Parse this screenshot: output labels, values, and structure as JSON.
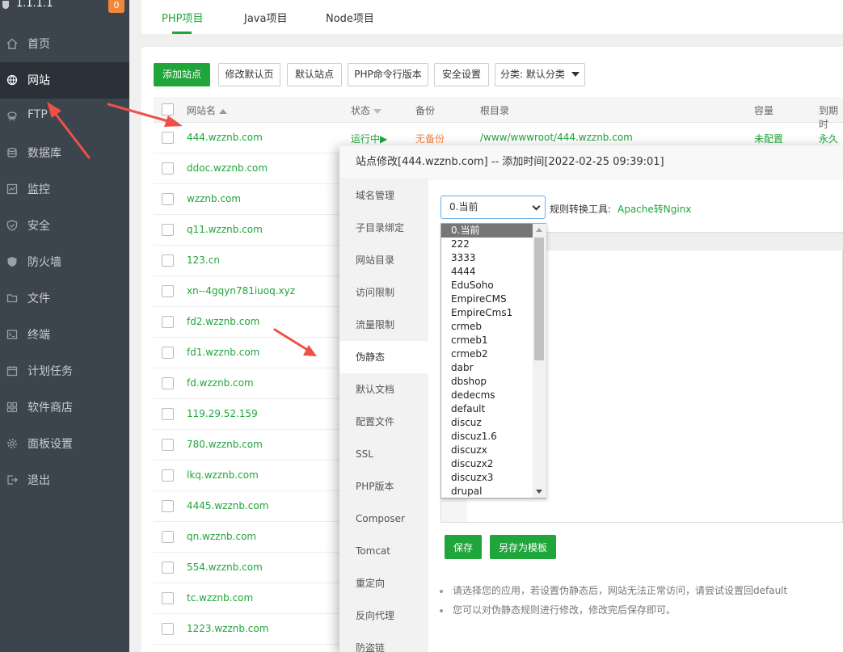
{
  "colors": {
    "accent": "#20a53a",
    "sidebar": "#3c444d",
    "badge": "#f0883c",
    "warn": "#f0883c",
    "arrow": "#f0504a"
  },
  "sidebar": {
    "server_ip": "1.1.1.1",
    "badge_count": "0",
    "items": [
      {
        "label": "首页",
        "icon": "home-icon"
      },
      {
        "label": "网站",
        "icon": "globe-icon"
      },
      {
        "label": "FTP",
        "icon": "ftp-icon"
      },
      {
        "label": "数据库",
        "icon": "database-icon"
      },
      {
        "label": "监控",
        "icon": "monitor-icon"
      },
      {
        "label": "安全",
        "icon": "shield-icon"
      },
      {
        "label": "防火墙",
        "icon": "firewall-icon"
      },
      {
        "label": "文件",
        "icon": "folder-icon"
      },
      {
        "label": "终端",
        "icon": "terminal-icon"
      },
      {
        "label": "计划任务",
        "icon": "calendar-icon"
      },
      {
        "label": "软件商店",
        "icon": "apps-icon"
      },
      {
        "label": "面板设置",
        "icon": "gear-icon"
      },
      {
        "label": "退出",
        "icon": "logout-icon"
      }
    ]
  },
  "top_tabs": [
    "PHP项目",
    "Java项目",
    "Node项目"
  ],
  "toolbar": {
    "add_site": "添加站点",
    "modify_default_page": "修改默认页",
    "default_site": "默认站点",
    "php_cli_version": "PHP命令行版本",
    "security_settings": "安全设置",
    "category": "分类: 默认分类"
  },
  "table": {
    "headers": {
      "site_name": "网站名",
      "status": "状态",
      "backup": "备份",
      "root_dir": "根目录",
      "quota": "容量",
      "expire": "到期时"
    },
    "first_row": {
      "status": "运行中▶",
      "backup": "无备份",
      "root": "/www/wwwroot/444.wzznb.com",
      "quota": "未配置",
      "expire": "永久"
    },
    "sites": [
      "444.wzznb.com",
      "ddoc.wzznb.com",
      "wzznb.com",
      "q11.wzznb.com",
      "123.cn",
      "xn--4gqyn781iuoq.xyz",
      "fd2.wzznb.com",
      "fd1.wzznb.com",
      "fd.wzznb.com",
      "119.29.52.159",
      "780.wzznb.com",
      "lkq.wzznb.com",
      "4445.wzznb.com",
      "qn.wzznb.com",
      "554.wzznb.com",
      "tc.wzznb.com",
      "1223.wzznb.com"
    ]
  },
  "modal": {
    "title": "站点修改[444.wzznb.com] -- 添加时间[2022-02-25 09:39:01]",
    "nav": [
      "域名管理",
      "子目录绑定",
      "网站目录",
      "访问限制",
      "流量限制",
      "伪静态",
      "默认文档",
      "配置文件",
      "SSL",
      "PHP版本",
      "Composer",
      "Tomcat",
      "重定向",
      "反向代理",
      "防盗链"
    ],
    "active_nav": "伪静态",
    "rule_select_value": "0.当前",
    "rule_tool_label": "规则转换工具:",
    "rule_tool_link": "Apache转Nginx",
    "save_button": "保存",
    "save_as_template_button": "另存为模板",
    "notes": [
      "请选择您的应用，若设置伪静态后，网站无法正常访问，请尝试设置回default",
      "您可以对伪静态规则进行修改，修改完后保存即可。"
    ]
  },
  "dropdown": {
    "options": [
      "0.当前",
      "222",
      "3333",
      "4444",
      "EduSoho",
      "EmpireCMS",
      "EmpireCms1",
      "crmeb",
      "crmeb1",
      "crmeb2",
      "dabr",
      "dbshop",
      "dedecms",
      "default",
      "discuz",
      "discuz1.6",
      "discuzx",
      "discuzx2",
      "discuzx3",
      "drupal"
    ],
    "selected": "0.当前"
  }
}
